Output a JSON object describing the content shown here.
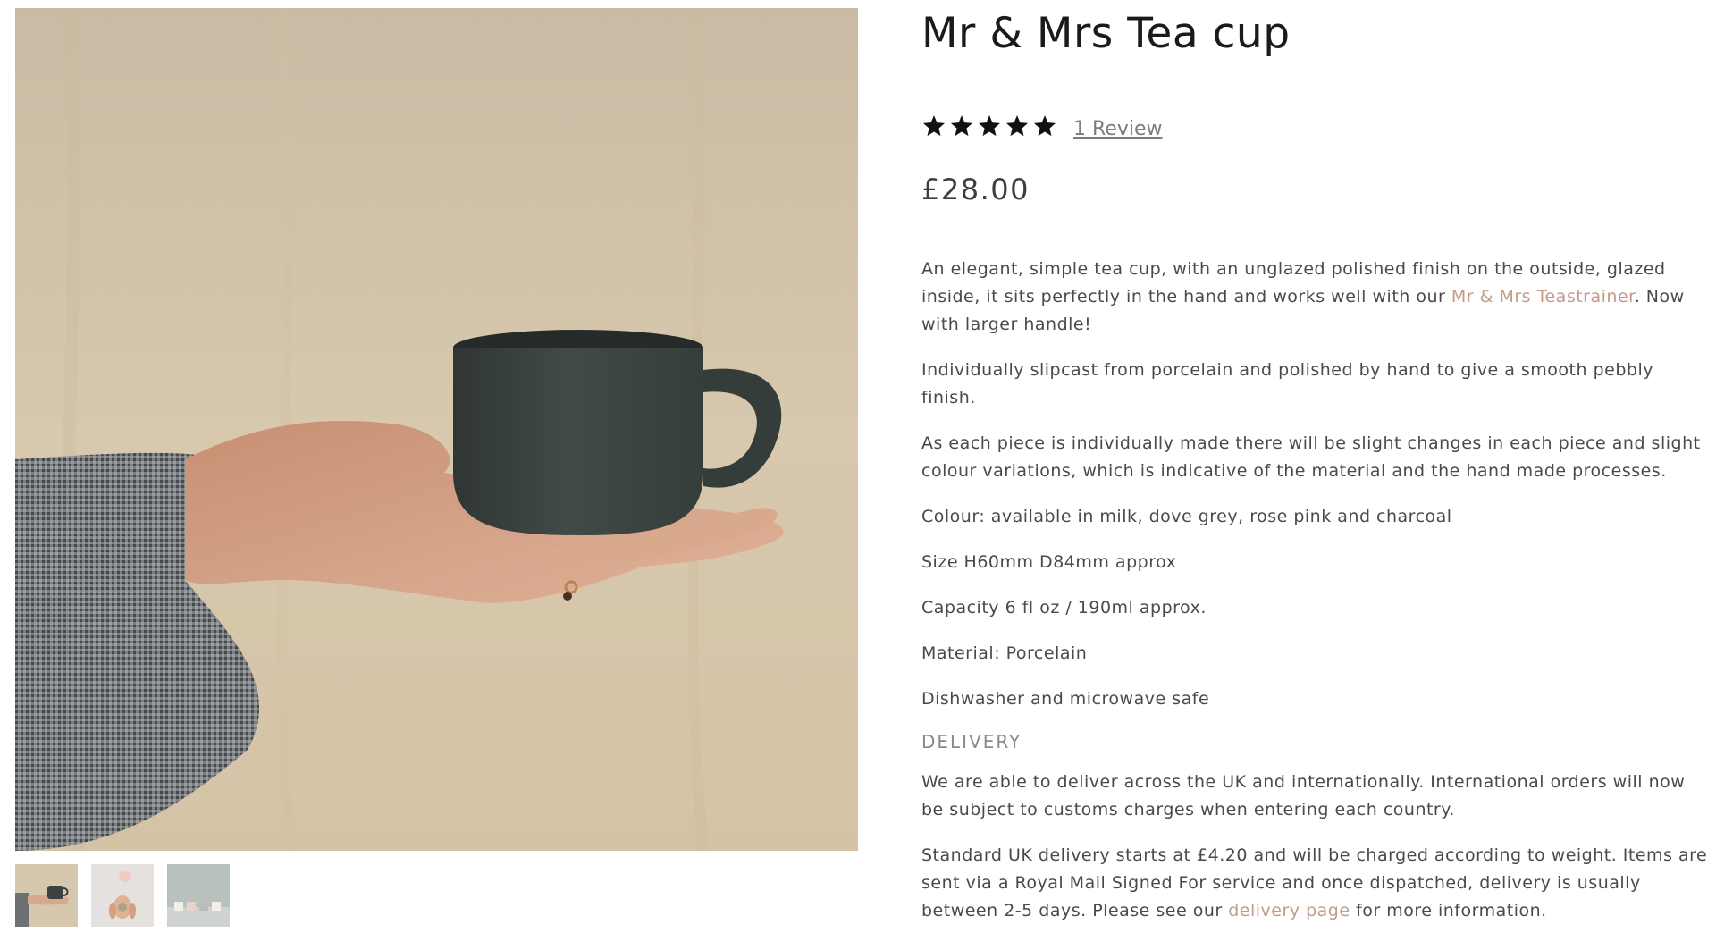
{
  "product": {
    "title": "Mr & Mrs Tea cup",
    "rating": 5,
    "rating_max": 5,
    "review_link": "1 Review",
    "price": "£28.00"
  },
  "description": {
    "p1_before": "An elegant, simple tea cup, with an unglazed polished finish on the outside, glazed inside, it sits perfectly in the hand and works well with our ",
    "p1_link": "Mr & Mrs Teastrainer",
    "p1_after": ".  Now with larger handle!",
    "p2": "Individually slipcast from porcelain and polished by hand to give a smooth pebbly finish.",
    "p3": "As each piece is individually made there will be slight changes in each piece and slight colour variations, which is indicative of the material and the hand made processes.",
    "colour": "Colour: available in milk, dove grey, rose pink and charcoal",
    "size": "Size H60mm D84mm approx",
    "capacity": "Capacity 6 fl oz / 190ml approx.",
    "material": "Material: Porcelain",
    "care": "Dishwasher and microwave safe"
  },
  "delivery": {
    "heading": "DELIVERY",
    "p1": "We are able to deliver across the UK and internationally. International orders will now be subject to customs charges when entering each country.",
    "p2_before": "Standard UK delivery starts at £4.20 and will be charged according to weight. Items are sent via a Royal Mail Signed For service and once dispatched, delivery is usually between 2-5 days. Please see our ",
    "p2_link": "delivery page",
    "p2_after": " for more information."
  },
  "gallery": {
    "thumbnails": [
      "thumbnail-hand-holding-cup",
      "thumbnail-hands-with-cups",
      "thumbnail-cups-row"
    ],
    "selected": 0
  },
  "colors": {
    "link": "#c49a88",
    "star": "#111111",
    "cup": "#3b4240",
    "background": "#d6c9b2"
  }
}
